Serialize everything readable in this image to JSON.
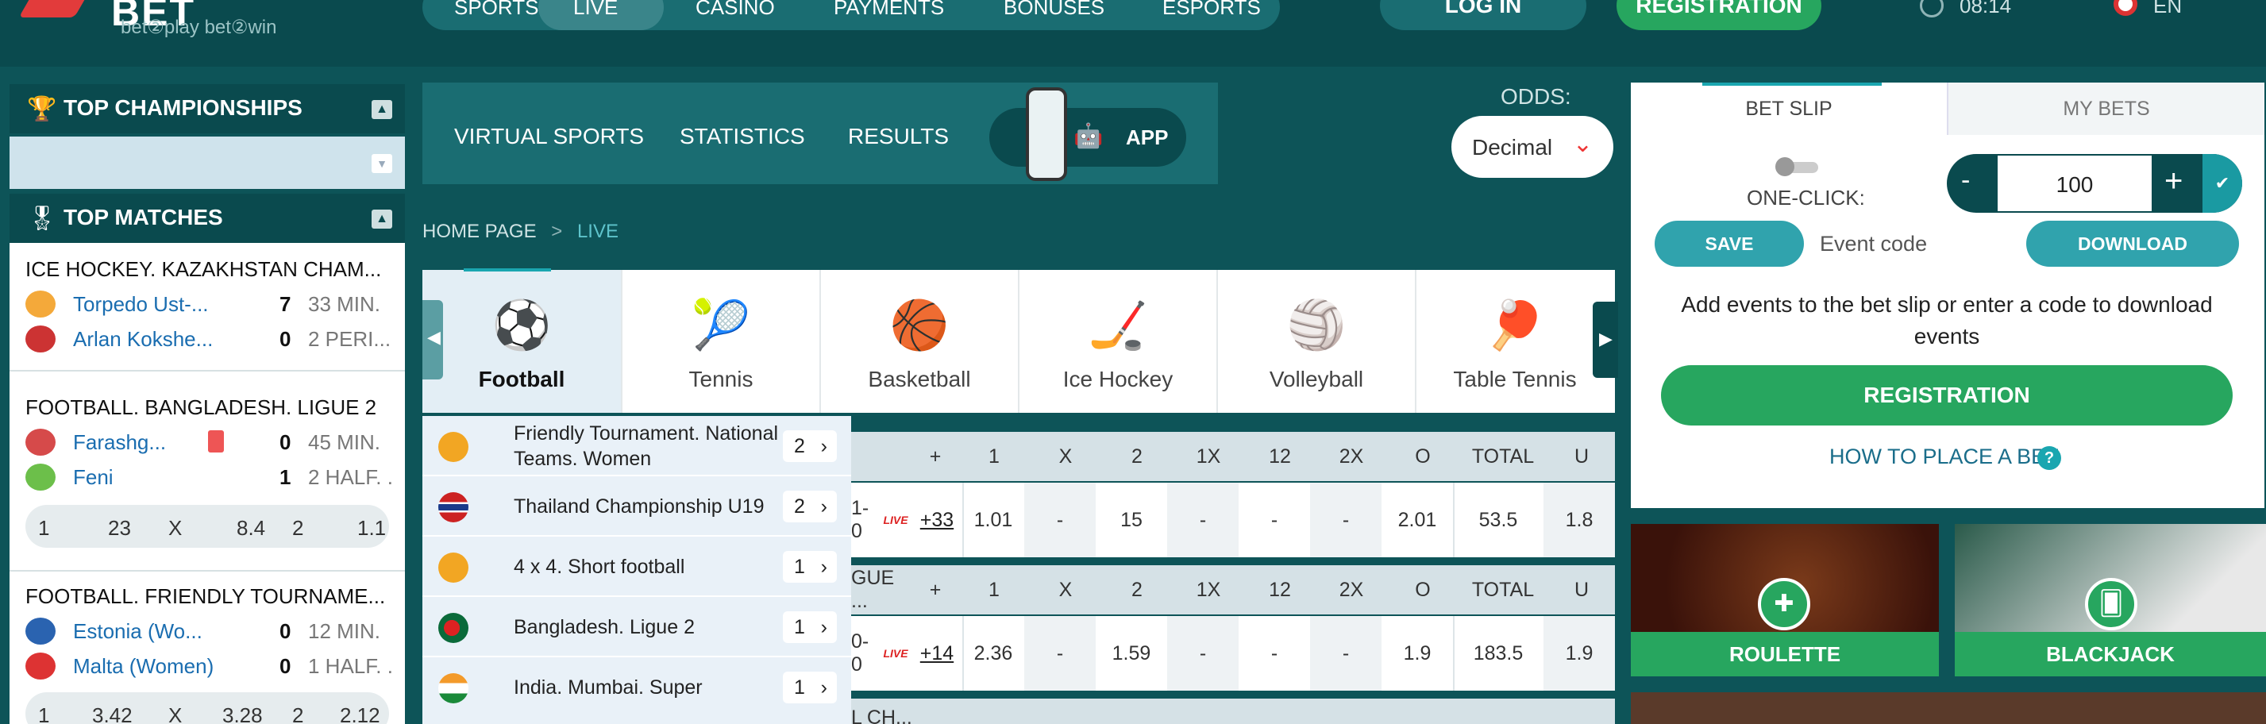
{
  "header": {
    "logo_text": "BET",
    "logo_sub": "bet②play bet②win",
    "nav": [
      "SPORTS",
      "LIVE",
      "CASINO",
      "PAYMENTS",
      "BONUSES",
      "ESPORTS"
    ],
    "login": "LOG IN",
    "registration": "REGISTRATION",
    "time": "08:14",
    "lang": "EN"
  },
  "sidebar": {
    "top_championships": "TOP CHAMPIONSHIPS",
    "top_matches": "TOP MATCHES",
    "matches": [
      {
        "title": "ICE HOCKEY. KAZAKHSTAN CHAM...",
        "team1": "Torpedo Ust-...",
        "score1": "7",
        "info1": "33 MIN.",
        "team2": "Arlan Kokshe...",
        "score2": "0",
        "info2": "2 PERI..."
      },
      {
        "title": "FOOTBALL. BANGLADESH. LIGUE 2",
        "team1": "Farashg...",
        "score1": "0",
        "info1": "45 MIN.",
        "team2": "Feni",
        "score2": "1",
        "info2": "2 HALF. .",
        "odds": [
          "1",
          "23",
          "X",
          "8.4",
          "2",
          "1.1"
        ]
      },
      {
        "title": "FOOTBALL. FRIENDLY TOURNAME...",
        "team1": "Estonia (Wo...",
        "score1": "0",
        "info1": "12 MIN.",
        "team2": "Malta (Women)",
        "score2": "0",
        "info2": "1 HALF. .",
        "odds": [
          "1",
          "3.42",
          "X",
          "3.28",
          "2",
          "2.12"
        ]
      }
    ]
  },
  "center": {
    "top_links": [
      "VIRTUAL SPORTS",
      "STATISTICS",
      "RESULTS"
    ],
    "app_label": "APP",
    "odds_label": "ODDS:",
    "odds_value": "Decimal",
    "breadcrumb_home": "HOME PAGE",
    "breadcrumb_sep": ">",
    "breadcrumb_current": "LIVE",
    "sports": [
      "Football",
      "Tennis",
      "Basketball",
      "Ice Hockey",
      "Volleyball",
      "Table Tennis"
    ],
    "championships": [
      {
        "name": "Friendly Tournament. National Teams. Women",
        "count": "2"
      },
      {
        "name": "Thailand Championship U19",
        "count": "2"
      },
      {
        "name": "4 x 4. Short football",
        "count": "1"
      },
      {
        "name": "Bangladesh. Ligue 2",
        "count": "1"
      },
      {
        "name": "India. Mumbai. Super",
        "count": "1"
      }
    ],
    "table_headers": [
      "+",
      "1",
      "X",
      "2",
      "1X",
      "12",
      "2X",
      "O",
      "TOTAL",
      "U"
    ],
    "section2_label": "GUE ...",
    "section3_label": "L CH...",
    "rows": [
      {
        "score": "1-0",
        "live": "LIVE",
        "plus": "+33",
        "odds": [
          "1.01",
          "-",
          "15",
          "-",
          "-",
          "-",
          "2.01",
          "53.5",
          "1.8"
        ]
      },
      {
        "score": "0-0",
        "live": "LIVE",
        "plus": "+14",
        "odds": [
          "2.36",
          "-",
          "1.59",
          "-",
          "-",
          "-",
          "1.9",
          "183.5",
          "1.9"
        ]
      }
    ]
  },
  "betslip": {
    "tab_betslip": "BET SLIP",
    "tab_mybets": "MY BETS",
    "one_click": "ONE-CLICK:",
    "stake": "100",
    "minus": "-",
    "plus": "+",
    "save": "SAVE",
    "event_code_placeholder": "Event code",
    "download": "DOWNLOAD",
    "message": "Add events to the bet slip or enter a code to download events",
    "registration": "REGISTRATION",
    "how_to": "HOW TO PLACE A BET"
  },
  "casino": [
    "ROULETTE",
    "BLACKJACK"
  ],
  "colors": {
    "bg": "#0d5458",
    "header": "#0a4a4e",
    "accent": "#1aa6b0",
    "green": "#27a65f"
  }
}
